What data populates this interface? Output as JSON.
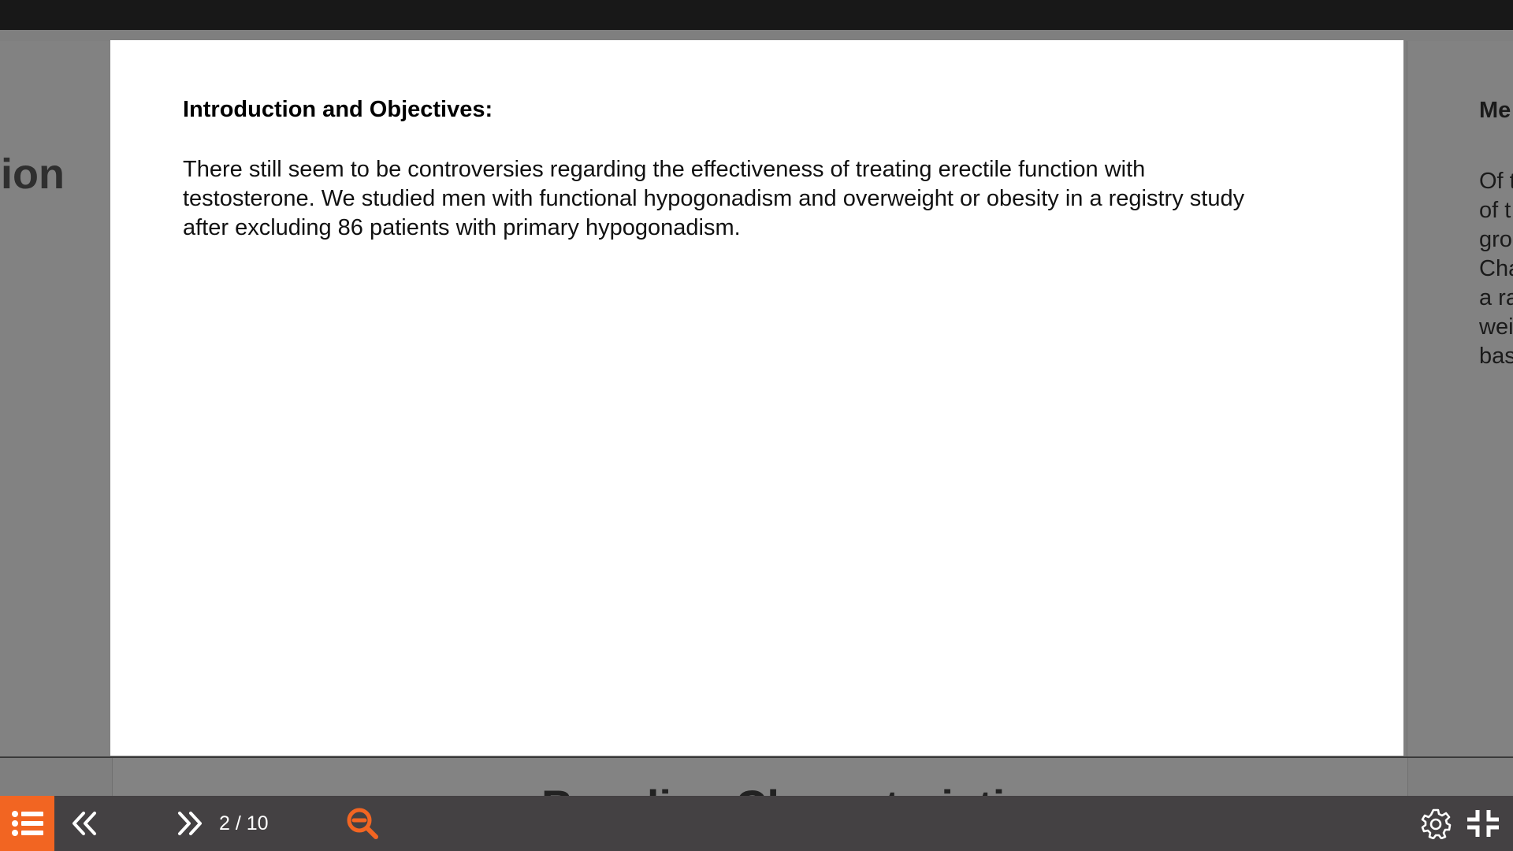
{
  "viewer": {
    "current_slide": {
      "heading": "Introduction and Objectives:",
      "body_lines": [
        "There still seem to be controversies regarding the effectiveness of treating erectile function with",
        "testosterone. We studied men with functional hypogonadism and overweight or obesity in a registry study",
        "after excluding 86 patients with primary hypogonadism."
      ]
    },
    "previous_slide": {
      "fragment": "ion"
    },
    "next_slide": {
      "heading": "Me",
      "body_lines": [
        "Of t",
        "of t",
        "gro",
        "Cha",
        "a ra",
        "wei",
        "bas"
      ]
    },
    "below_slide": {
      "title_peek": "Baseline Characteristics"
    }
  },
  "toolbar": {
    "page_counter": "2 / 10",
    "accent_color": "#f26522",
    "icons": {
      "menu": "list-icon",
      "prev": "double-chevron-left-icon",
      "next": "double-chevron-right-icon",
      "zoom": "zoom-out-icon",
      "settings": "gear-icon",
      "fullscreen": "exit-fullscreen-icon"
    }
  }
}
